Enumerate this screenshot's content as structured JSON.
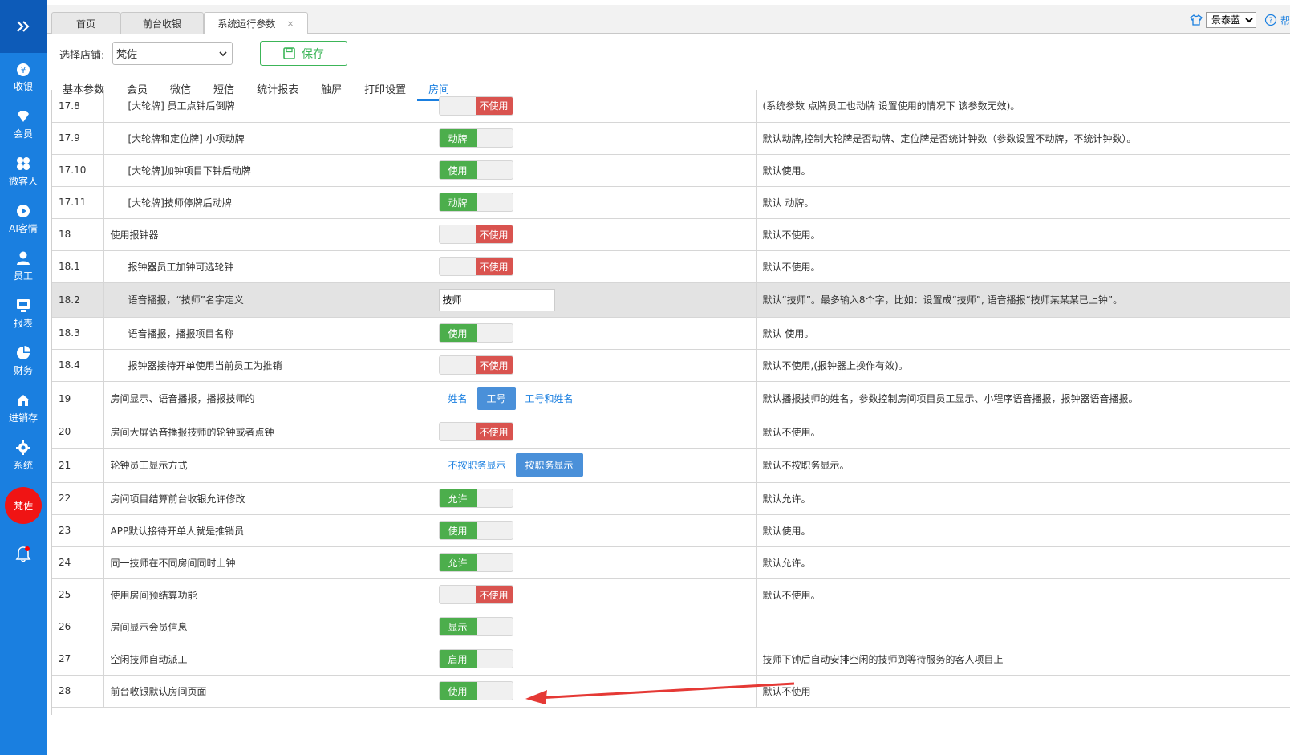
{
  "sidebar": {
    "items": [
      {
        "label": "收银",
        "icon": "cashier-icon"
      },
      {
        "label": "会员",
        "icon": "diamond-icon"
      },
      {
        "label": "微客人",
        "icon": "grid-icon"
      },
      {
        "label": "AI客情",
        "icon": "play-icon"
      },
      {
        "label": "员工",
        "icon": "user-icon"
      },
      {
        "label": "报表",
        "icon": "monitor-icon"
      },
      {
        "label": "财务",
        "icon": "pie-icon"
      },
      {
        "label": "进销存",
        "icon": "home-icon"
      },
      {
        "label": "系统",
        "icon": "gear-icon"
      }
    ],
    "avatar": "梵佐"
  },
  "top_tabs": [
    {
      "label": "首页"
    },
    {
      "label": "前台收银"
    },
    {
      "label": "系统运行参数",
      "close": "×"
    }
  ],
  "theme": {
    "selected": "景泰蓝"
  },
  "help": {
    "label": "帮"
  },
  "toolbar": {
    "store_label": "选择店铺:",
    "store_value": "梵佐",
    "save_label": "保存"
  },
  "subtabs": [
    "基本参数",
    "会员",
    "微信",
    "短信",
    "统计报表",
    "触屏",
    "打印设置",
    "房间"
  ],
  "rows": [
    {
      "num": "17.8",
      "name": "[大轮牌] 员工点钟后倒牌",
      "indent": true,
      "type": "toggle",
      "state": "off",
      "value": "不使用",
      "desc": "(系统参数 点牌员工也动牌 设置使用的情况下 该参数无效)。"
    },
    {
      "num": "17.9",
      "name": "[大轮牌和定位牌] 小项动牌",
      "indent": true,
      "type": "toggle",
      "state": "on",
      "value": "动牌",
      "desc": "默认动牌,控制大轮牌是否动牌、定位牌是否统计钟数（参数设置不动牌，不统计钟数）。"
    },
    {
      "num": "17.10",
      "name": "[大轮牌]加钟项目下钟后动牌",
      "indent": true,
      "type": "toggle",
      "state": "on",
      "value": "使用",
      "desc": "默认使用。"
    },
    {
      "num": "17.11",
      "name": "[大轮牌]技师停牌后动牌",
      "indent": true,
      "type": "toggle",
      "state": "on",
      "value": "动牌",
      "desc": "默认 动牌。"
    },
    {
      "num": "18",
      "name": "使用报钟器",
      "indent": false,
      "type": "toggle",
      "state": "off",
      "value": "不使用",
      "desc": "默认不使用。"
    },
    {
      "num": "18.1",
      "name": "报钟器员工加钟可选轮钟",
      "indent": true,
      "type": "toggle",
      "state": "off",
      "value": "不使用",
      "desc": "默认不使用。"
    },
    {
      "num": "18.2",
      "name": "语音播报，“技师”名字定义",
      "indent": true,
      "type": "input",
      "value": "技师",
      "desc": "默认“技师”。最多输入8个字，比如：设置成“技师”, 语音播报“技师某某某已上钟”。",
      "highlight": true
    },
    {
      "num": "18.3",
      "name": "语音播报，播报项目名称",
      "indent": true,
      "type": "toggle",
      "state": "on",
      "value": "使用",
      "desc": "默认 使用。"
    },
    {
      "num": "18.4",
      "name": "报钟器接待开单使用当前员工为推销",
      "indent": true,
      "type": "toggle",
      "state": "off",
      "value": "不使用",
      "desc": "默认不使用,(报钟器上操作有效)。"
    },
    {
      "num": "19",
      "name": "房间显示、语音播报，播报技师的",
      "indent": false,
      "type": "segment",
      "options": [
        "姓名",
        "工号",
        "工号和姓名"
      ],
      "selected": 1,
      "desc": "默认播报技师的姓名，参数控制房间项目员工显示、小程序语音播报，报钟器语音播报。"
    },
    {
      "num": "20",
      "name": "房间大屏语音播报技师的轮钟或者点钟",
      "indent": false,
      "type": "toggle",
      "state": "off",
      "value": "不使用",
      "desc": "默认不使用。"
    },
    {
      "num": "21",
      "name": "轮钟员工显示方式",
      "indent": false,
      "type": "segment",
      "options": [
        "不按职务显示",
        "按职务显示"
      ],
      "selected": 1,
      "desc": "默认不按职务显示。"
    },
    {
      "num": "22",
      "name": "房间项目结算前台收银允许修改",
      "indent": false,
      "type": "toggle",
      "state": "on",
      "value": "允许",
      "desc": "默认允许。"
    },
    {
      "num": "23",
      "name": "APP默认接待开单人就是推销员",
      "indent": false,
      "type": "toggle",
      "state": "on",
      "value": "使用",
      "desc": "默认使用。"
    },
    {
      "num": "24",
      "name": "同一技师在不同房间同时上钟",
      "indent": false,
      "type": "toggle",
      "state": "on",
      "value": "允许",
      "desc": "默认允许。"
    },
    {
      "num": "25",
      "name": "使用房间预结算功能",
      "indent": false,
      "type": "toggle",
      "state": "off",
      "value": "不使用",
      "desc": "默认不使用。"
    },
    {
      "num": "26",
      "name": "房间显示会员信息",
      "indent": false,
      "type": "toggle",
      "state": "on",
      "value": "显示",
      "desc": ""
    },
    {
      "num": "27",
      "name": "空闲技师自动派工",
      "indent": false,
      "type": "toggle",
      "state": "on",
      "value": "启用",
      "desc": "技师下钟后自动安排空闲的技师到等待服务的客人项目上"
    },
    {
      "num": "28",
      "name": "前台收银默认房间页面",
      "indent": false,
      "type": "toggle",
      "state": "on",
      "value": "使用",
      "desc": "默认不使用"
    }
  ],
  "colors": {
    "accent": "#1a7fe0",
    "on": "#4cae4c",
    "off": "#d9534f",
    "annotation": "#e53935"
  }
}
